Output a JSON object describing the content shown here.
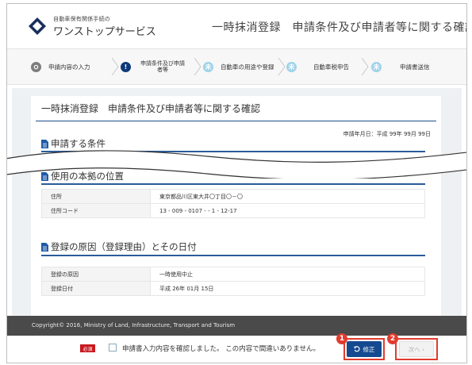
{
  "header": {
    "logo_sub": "自動車保有関係手続の",
    "logo_main": "ワンストップサービス",
    "title": "一時抹消登録　申請条件及び申請者等に関する確認"
  },
  "steps": [
    {
      "num": "",
      "label": "申請内容の入力",
      "state": "done"
    },
    {
      "num": "!",
      "label": "申請条件及び申請者等",
      "state": "active"
    },
    {
      "num": "未",
      "label": "自動車の用途や登録",
      "state": "todo"
    },
    {
      "num": "未",
      "label": "自動車税申告",
      "state": "todo"
    },
    {
      "num": "未",
      "label": "申請書送信",
      "state": "todo"
    }
  ],
  "page": {
    "title": "一時抹消登録　申請条件及び申請者等に関する確認",
    "application_date": "申請年月日：平成 99年 99月 99日"
  },
  "sections": {
    "conditions": {
      "title": "申請する条件"
    },
    "location": {
      "title": "使用の本拠の位置",
      "rows": [
        {
          "key": "住所",
          "value": "東京都品川区東大井〇丁目〇－〇"
        },
        {
          "key": "住所コード",
          "value": "13 - 009 - 0107 - - 1 - 12-17"
        }
      ]
    },
    "reason": {
      "title": "登録の原因（登録理由）とその日付",
      "rows": [
        {
          "key": "登録の原因",
          "value": "一時使用中止"
        },
        {
          "key": "登録日付",
          "value": "平成 26年 01月 15日"
        }
      ]
    }
  },
  "footer": {
    "copyright": "Copyright© 2016, Ministry of Land, Infrastructure, Transport and Tourism"
  },
  "bottom": {
    "required_badge": "必須",
    "confirm_text": "申請書入力内容を確認しました。 この内容で間違いありません。",
    "fix_button": "修正",
    "next_button": "次へ ›",
    "markers": [
      "1",
      "2"
    ]
  },
  "colors": {
    "brand_navy": "#144a8f",
    "required_red": "#c8191e",
    "highlight_red": "#e23b2e",
    "todo_blue": "#9ed2e9"
  }
}
